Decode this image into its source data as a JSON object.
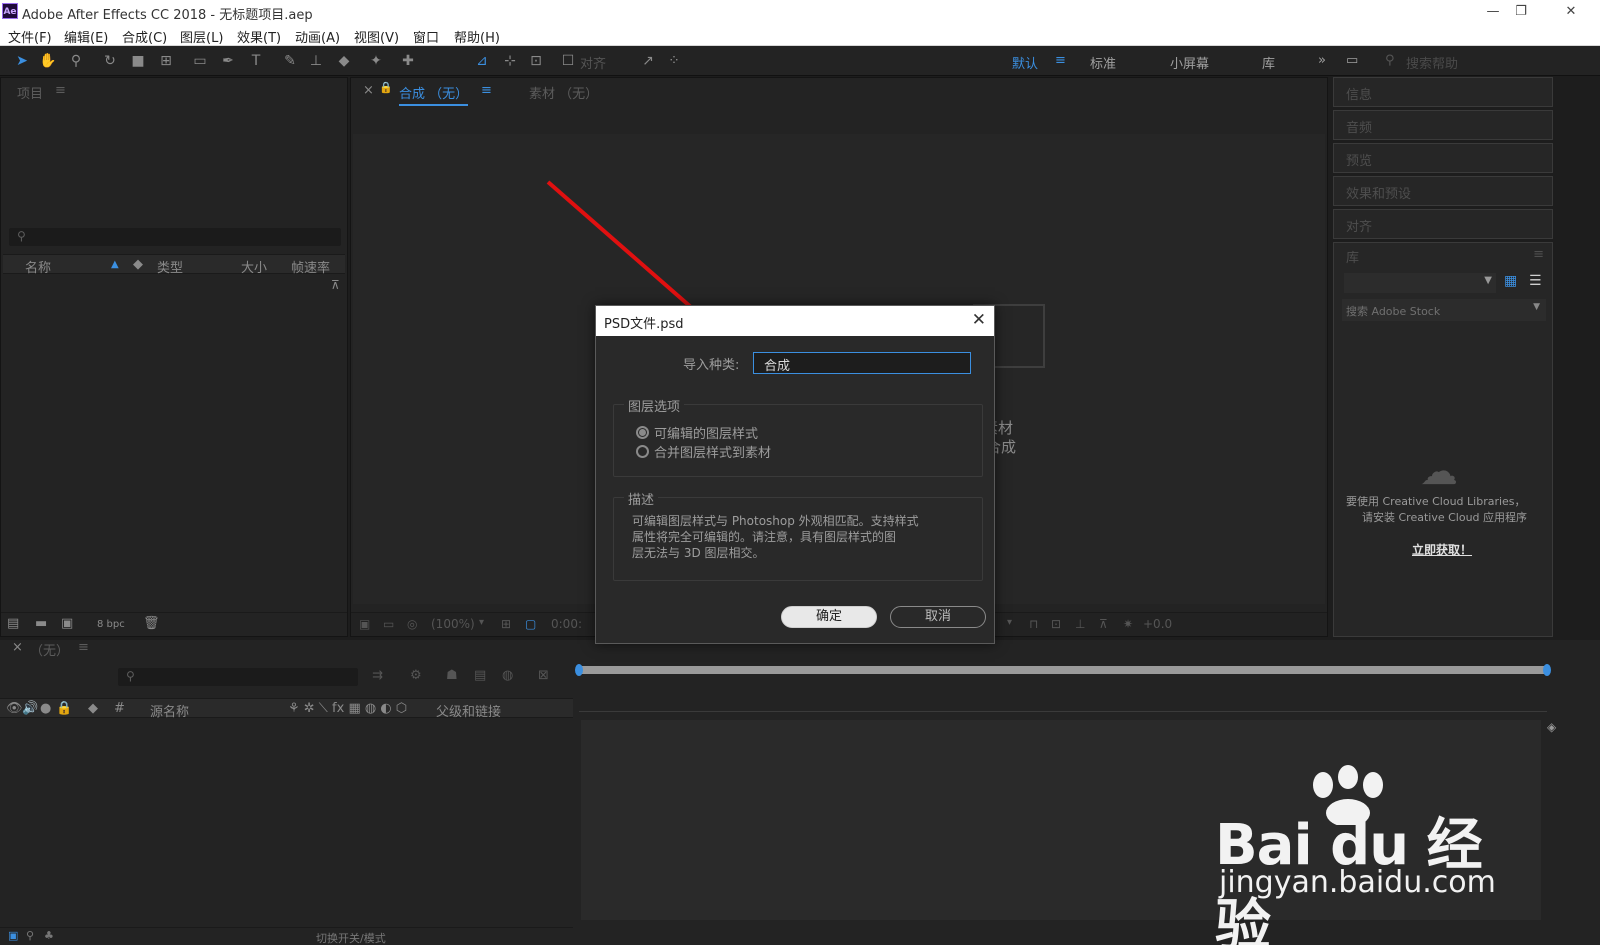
{
  "window": {
    "title": "Adobe After Effects CC 2018 - 无标题项目.aep",
    "logo_text": "Ae"
  },
  "menu": [
    "文件(F)",
    "编辑(E)",
    "合成(C)",
    "图层(L)",
    "效果(T)",
    "动画(A)",
    "视图(V)",
    "窗口",
    "帮助(H)"
  ],
  "toolbar": {
    "align_label": "对齐",
    "workspaces": [
      "默认",
      "标准",
      "小屏幕",
      "库"
    ],
    "search_placeholder": "搜索帮助"
  },
  "project_panel": {
    "title": "项目",
    "columns": [
      "名称",
      "类型",
      "大小",
      "帧速率"
    ],
    "footer_bpc": "8 bpc"
  },
  "comp_panel": {
    "tab_comp": "合成 （无）",
    "tab_footage": "素材 （无）",
    "hint_line1": "素材",
    "hint_line2": "成合成",
    "zoom": "(100%)",
    "time": "0:00:",
    "exposure": "+0.0"
  },
  "right_panels": [
    "信息",
    "音频",
    "预览",
    "效果和预设",
    "对齐",
    "库"
  ],
  "library": {
    "search_placeholder": "搜索 Adobe Stock",
    "message_line1": "要使用 Creative Cloud Libraries，",
    "message_line2": "请安装 Creative Cloud 应用程序",
    "link": "立即获取！"
  },
  "timeline": {
    "tab": "（无）",
    "columns": [
      "源名称",
      "父级和链接"
    ],
    "footer_label": "切换开关/模式"
  },
  "dialog": {
    "title": "PSD文件.psd",
    "import_label": "导入种类:",
    "import_value": "合成",
    "layer_options_title": "图层选项",
    "option1": "可编辑的图层样式",
    "option2": "合并图层样式到素材",
    "desc_title": "描述",
    "desc_line1": "可编辑图层样式与 Photoshop 外观相匹配。支持样式",
    "desc_line2": "属性将完全可编辑的。请注意，具有图层样式的图",
    "desc_line3": "层无法与 3D 图层相交。",
    "ok": "确定",
    "cancel": "取消"
  },
  "watermark": {
    "main": "Bai du 经验",
    "sub": "jingyan.baidu.com"
  },
  "colors": {
    "accent": "#3b8fe0",
    "arrow": "#e01010",
    "panel": "#232323"
  }
}
